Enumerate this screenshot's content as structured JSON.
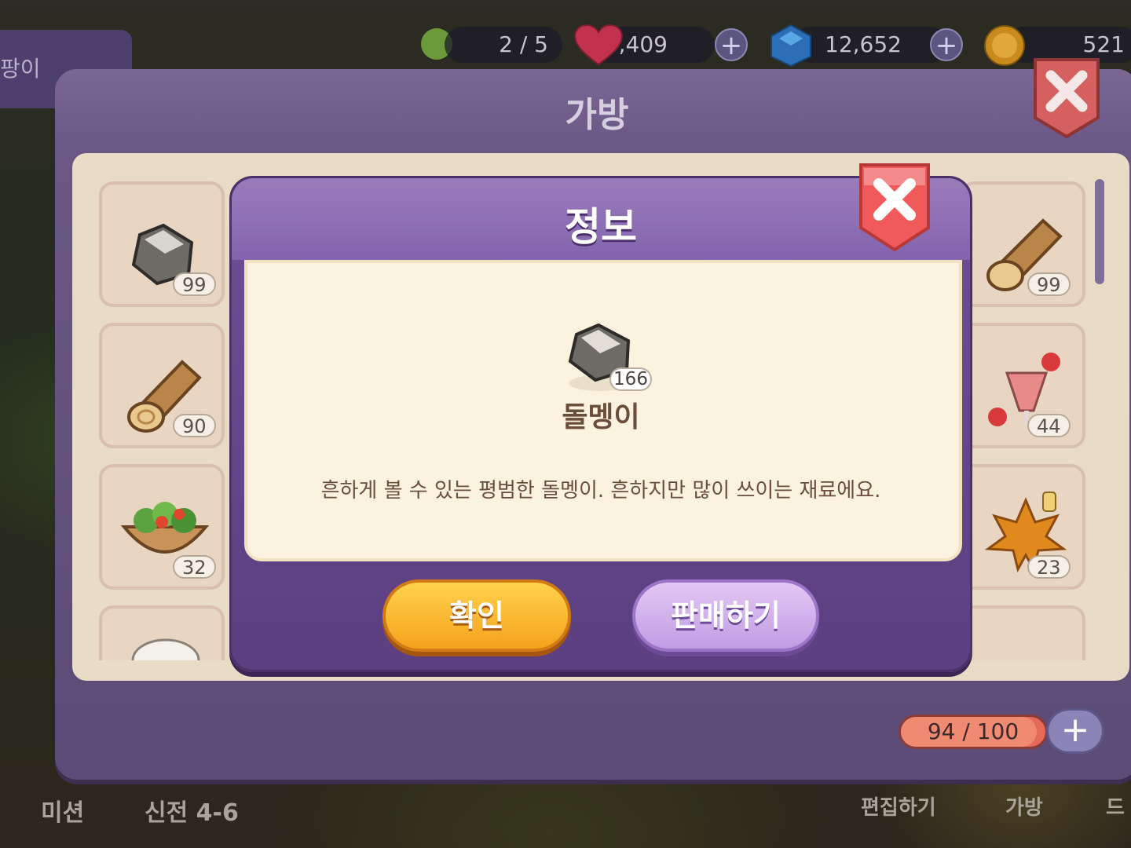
{
  "topbar": {
    "stamina": "2 / 5",
    "hearts": "13,409",
    "gems": "12,652",
    "coins": "521"
  },
  "background": {
    "left_tag": "팡이",
    "nav": [
      "미션",
      "신전 4-6",
      "편집하기",
      "가방",
      "드"
    ]
  },
  "bag": {
    "title": "가방",
    "left_counts": [
      "99",
      "90",
      "32"
    ],
    "right_counts": [
      "99",
      "44",
      "23"
    ],
    "capacity": "94 / 100",
    "capacity_fraction": 0.94
  },
  "info_modal": {
    "title": "정보",
    "item_name": "돌멩이",
    "item_count": "166",
    "description": "흔하게 볼 수 있는 평범한 돌멩이. 흔하지만 많이 쓰이는 재료에요.",
    "confirm_label": "확인",
    "sell_label": "판매하기"
  },
  "icons": [
    "close-icon",
    "plus-icon",
    "heart-icon",
    "gem-icon",
    "coin-icon",
    "stone-icon",
    "log-icon",
    "salad-icon",
    "juice-icon",
    "maple-syrup-icon"
  ],
  "colors": {
    "confirm": "#f5a21c",
    "sell": "#c19ce3",
    "close": "#e84c4c",
    "panel": "#6e4f93"
  }
}
